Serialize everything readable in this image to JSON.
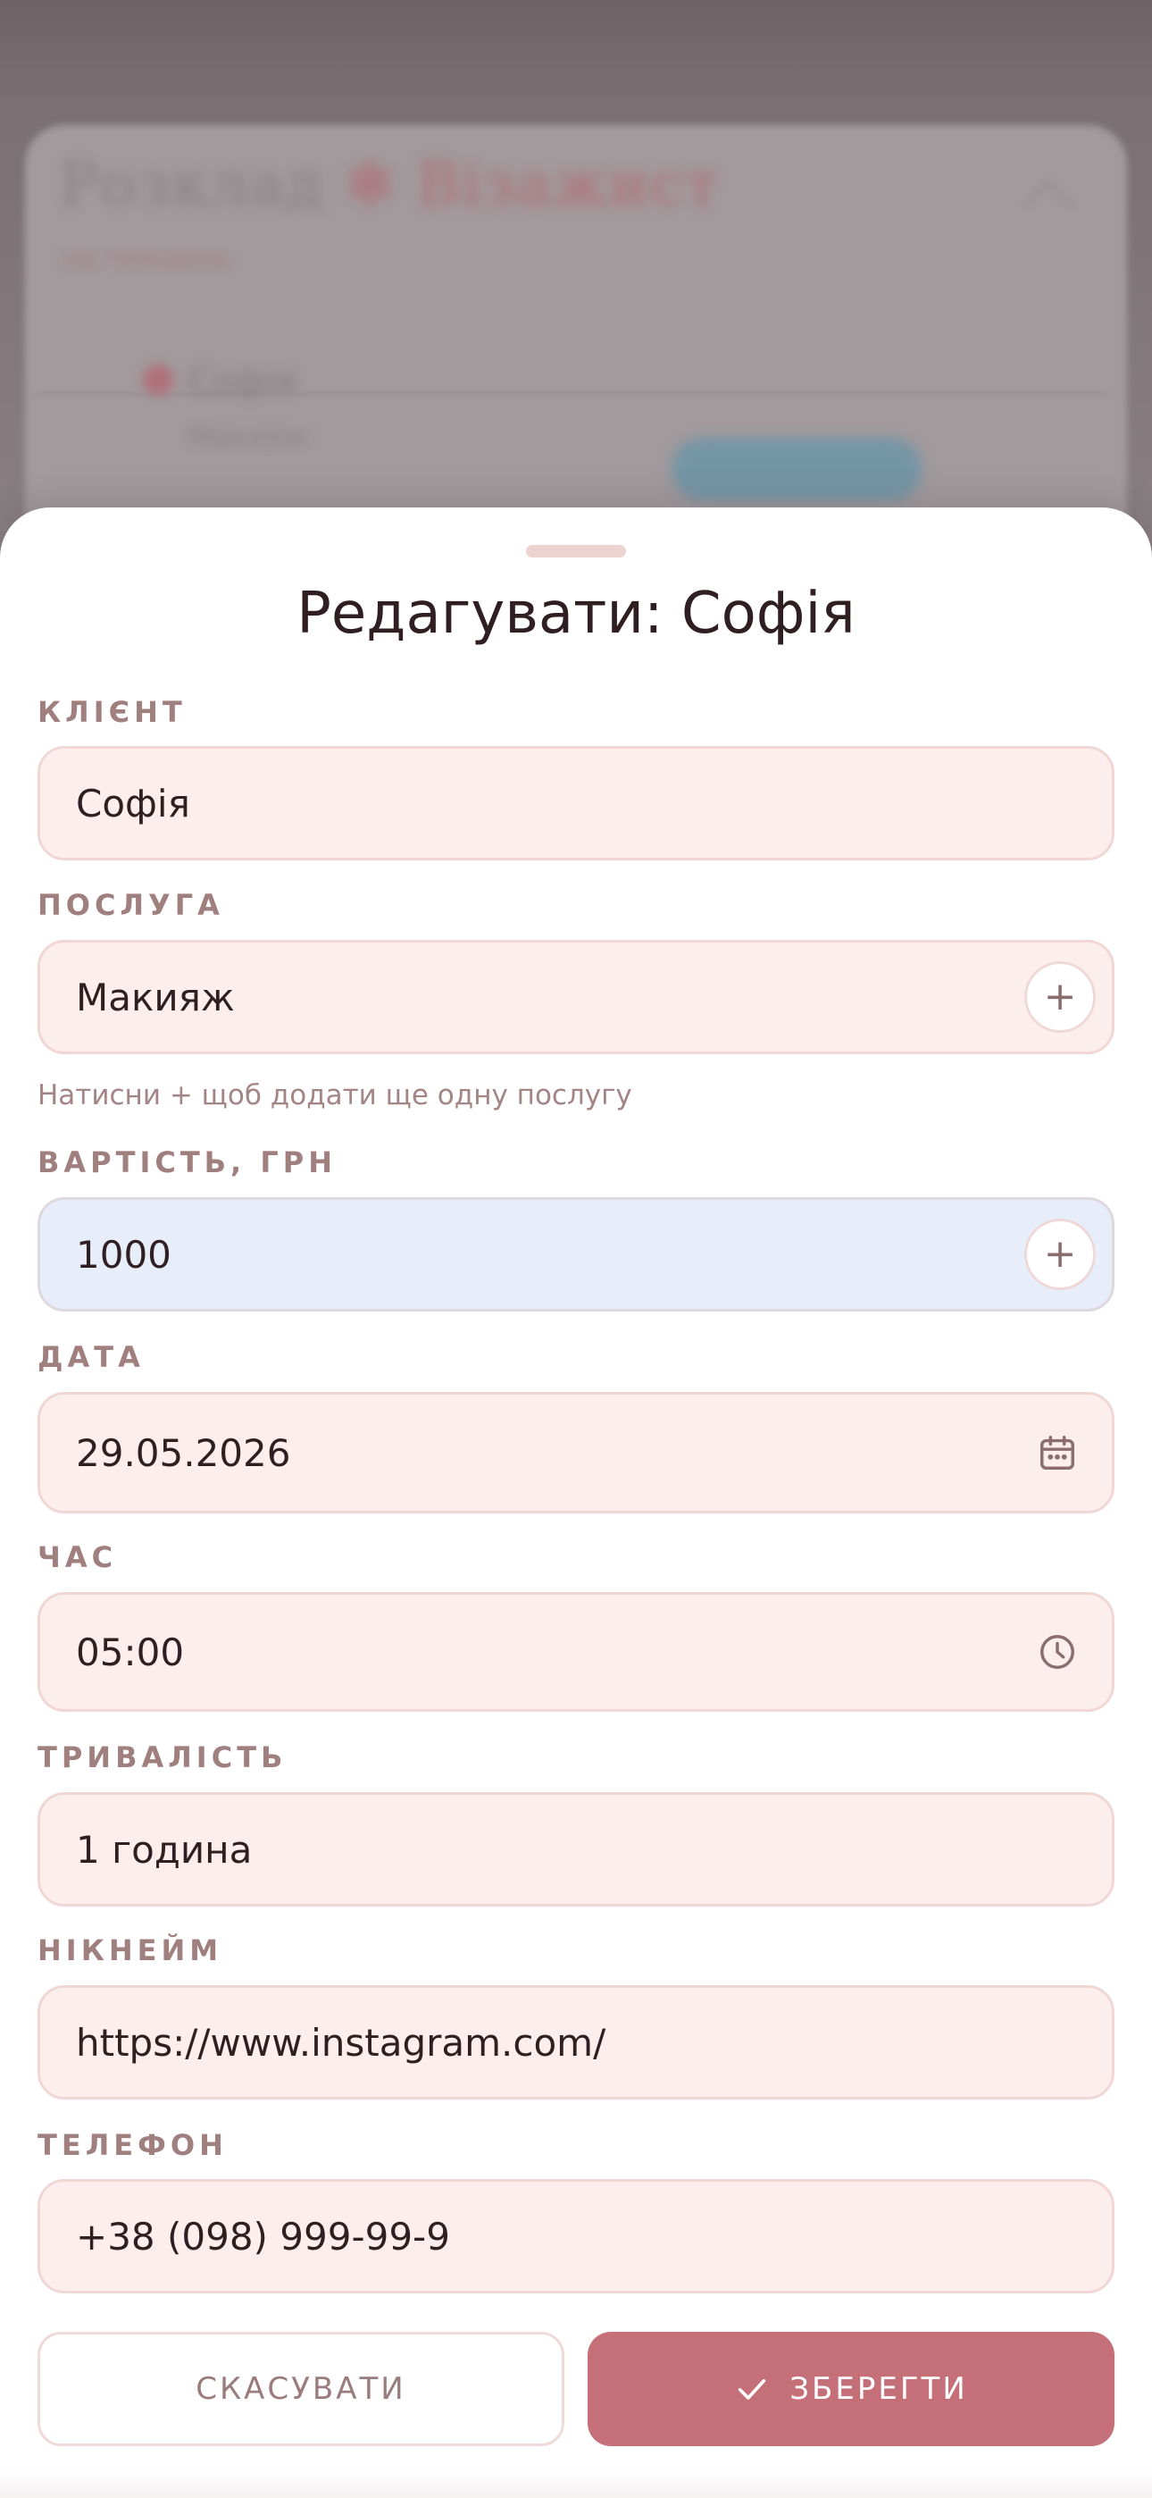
{
  "background": {
    "title_part1": "Розклад",
    "title_part2": "Візажист",
    "subtitle": "на тиждень",
    "row_name": "Софія",
    "row_detail": "Макияж"
  },
  "sheet": {
    "title": "Редагувати: Софія",
    "fields": {
      "client": {
        "label": "КЛІЄНТ",
        "value": "Софія"
      },
      "service": {
        "label": "ПОСЛУГА",
        "value": "Макияж",
        "hint": "Натисни + щоб додати ще одну послугу"
      },
      "price": {
        "label": "ВАРТІСТЬ, ГРН",
        "value": "1000"
      },
      "date": {
        "label": "ДАТА",
        "value": "29.05.2026"
      },
      "time": {
        "label": "ЧАС",
        "value": "05:00"
      },
      "duration": {
        "label": "ТРИВАЛІСТЬ",
        "value": "1 година"
      },
      "nickname": {
        "label": "НІКНЕЙМ",
        "value": "https://www.instagram.com/"
      },
      "phone": {
        "label": "ТЕЛЕФОН",
        "value": "+38 (098) 999-99-9"
      }
    },
    "plus_glyph": "+",
    "actions": {
      "cancel_label": "СКАСУВАТИ",
      "save_label": "ЗБЕРЕГТИ"
    }
  },
  "colors": {
    "accent": "#c57078",
    "field_bg": "#fbeeed",
    "field_focus_bg": "#e7eef9",
    "label": "#a07f7f"
  },
  "icons": [
    "plus-icon",
    "calendar-icon",
    "clock-icon",
    "check-icon"
  ]
}
